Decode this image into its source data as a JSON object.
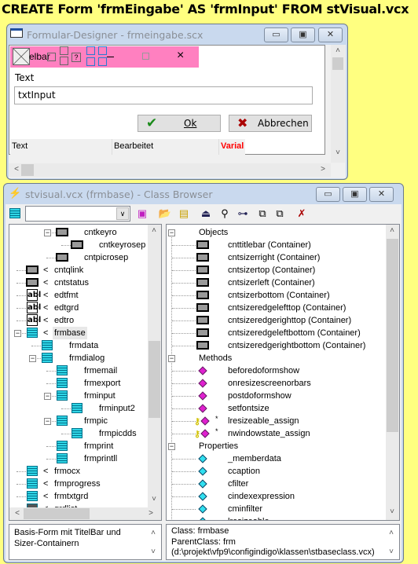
{
  "headline": "CREATE Form 'frmEingabe' AS 'frmInput' FROM stVisual.vcx",
  "designer": {
    "title": "Formular-Designer - frmeingabe.scx",
    "titlebar_fragment": "elbar",
    "help_glyph": "?",
    "close_glyph": "×",
    "label": "Text",
    "input_value": "txtInput",
    "ok_label": "Ok",
    "cancel_label": "Abbrechen",
    "status": [
      "Text",
      "Bearbeitet",
      "Varial"
    ],
    "status_accent": "#FF0000",
    "titlebar_color": "#FF80C0"
  },
  "browser": {
    "title": "stvisual.vcx (frmbase) - Class Browser",
    "combo_value": "",
    "toolbar": [
      "view-icon",
      "class-library-icon",
      "open-icon",
      "new-class-icon",
      "redefine-icon",
      "find-icon",
      "hierarchy-icon",
      "copy-icon",
      "rename-icon",
      "remove-icon"
    ],
    "tree": [
      {
        "label": "cntkeyro",
        "level": 2,
        "icon": "cnt",
        "exp": true
      },
      {
        "label": "cntkeyrosep",
        "level": 3,
        "icon": "cnt"
      },
      {
        "label": "cntpicrosep",
        "level": 2,
        "icon": "cnt"
      },
      {
        "label": "cntqlink",
        "level": 0,
        "icon": "cnt",
        "mark": "<"
      },
      {
        "label": "cntstatus",
        "level": 0,
        "icon": "cnt",
        "mark": "<"
      },
      {
        "label": "edtfmt",
        "level": 0,
        "icon": "edt",
        "mark": "<"
      },
      {
        "label": "edtgrd",
        "level": 0,
        "icon": "edt",
        "mark": "<"
      },
      {
        "label": "edtro",
        "level": 0,
        "icon": "edt",
        "mark": "<"
      },
      {
        "label": "frmbase",
        "level": 0,
        "icon": "frm",
        "mark": "<",
        "exp": true,
        "selected": true
      },
      {
        "label": "frmdata",
        "level": 1,
        "icon": "frm"
      },
      {
        "label": "frmdialog",
        "level": 1,
        "icon": "frm",
        "exp": true
      },
      {
        "label": "frmemail",
        "level": 2,
        "icon": "frm"
      },
      {
        "label": "frmexport",
        "level": 2,
        "icon": "frm"
      },
      {
        "label": "frminput",
        "level": 2,
        "icon": "frm",
        "exp": true
      },
      {
        "label": "frminput2",
        "level": 3,
        "icon": "frm"
      },
      {
        "label": "frmpic",
        "level": 2,
        "icon": "frm",
        "exp": true
      },
      {
        "label": "frmpicdds",
        "level": 3,
        "icon": "frm"
      },
      {
        "label": "frmprint",
        "level": 2,
        "icon": "frm"
      },
      {
        "label": "frmprintll",
        "level": 2,
        "icon": "frm"
      },
      {
        "label": "frmocx",
        "level": 0,
        "icon": "frm",
        "mark": "<"
      },
      {
        "label": "frmprogress",
        "level": 0,
        "icon": "frm",
        "mark": "<"
      },
      {
        "label": "frmtxtgrd",
        "level": 0,
        "icon": "frm",
        "mark": "<"
      },
      {
        "label": "grdlist",
        "level": 0,
        "icon": "grd",
        "mark": "<"
      }
    ],
    "members": [
      {
        "group": "Objects"
      },
      {
        "label": "cnttitlebar  (Container)",
        "icon": "cnt"
      },
      {
        "label": "cntsizerright  (Container)",
        "icon": "cnt"
      },
      {
        "label": "cntsizertop  (Container)",
        "icon": "cnt"
      },
      {
        "label": "cntsizerleft  (Container)",
        "icon": "cnt"
      },
      {
        "label": "cntsizerbottom  (Container)",
        "icon": "cnt"
      },
      {
        "label": "cntsizeredgelefttop  (Container)",
        "icon": "cnt"
      },
      {
        "label": "cntsizeredgerighttop  (Container)",
        "icon": "cnt"
      },
      {
        "label": "cntsizeredgeleftbottom  (Container)",
        "icon": "cnt"
      },
      {
        "label": "cntsizeredgerightbottom  (Container)",
        "icon": "cnt"
      },
      {
        "group": "Methods"
      },
      {
        "label": "beforedoformshow",
        "icon": "m"
      },
      {
        "label": "onresizescreenorbars",
        "icon": "m"
      },
      {
        "label": "postdoformshow",
        "icon": "m"
      },
      {
        "label": "setfontsize",
        "icon": "m"
      },
      {
        "label": "lresizeable_assign",
        "icon": "m",
        "key": true,
        "star": "*"
      },
      {
        "label": "nwindowstate_assign",
        "icon": "m",
        "key": true,
        "star": "*"
      },
      {
        "group": "Properties"
      },
      {
        "label": "_memberdata",
        "icon": "p"
      },
      {
        "label": "ccaption",
        "icon": "p"
      },
      {
        "label": "cfilter",
        "icon": "p"
      },
      {
        "label": "cindexexpression",
        "icon": "p"
      },
      {
        "label": "cminfilter",
        "icon": "p"
      },
      {
        "label": "lresizeable",
        "icon": "p"
      }
    ],
    "description": "Basis-Form mit TitelBar und Sizer-Containern",
    "class_info": [
      "Class:  frmbase",
      "ParentClass:  frm",
      "(d:\\projekt\\vfp9\\configindigo\\klassen\\stbaseclass.vcx)"
    ]
  }
}
